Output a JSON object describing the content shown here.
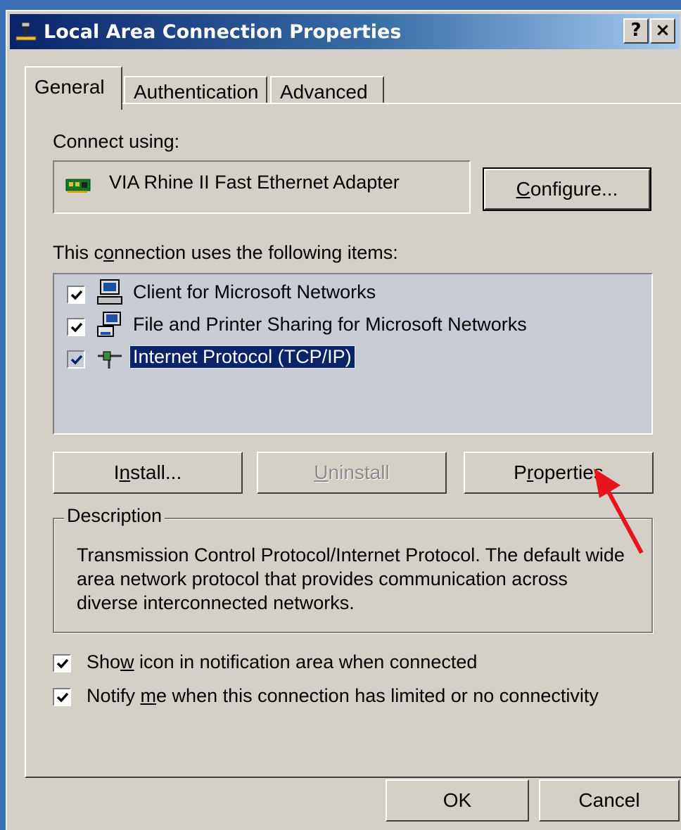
{
  "window": {
    "title": "Local Area Connection Properties",
    "help_button": "?",
    "close_button": "×"
  },
  "tabs": [
    {
      "label": "General",
      "active": true
    },
    {
      "label": "Authentication",
      "active": false
    },
    {
      "label": "Advanced",
      "active": false
    }
  ],
  "connect_using": {
    "label": "Connect using:",
    "adapter": "VIA Rhine II Fast Ethernet Adapter",
    "configure_button": {
      "pre": "",
      "mnemonic": "C",
      "post": "onfigure..."
    }
  },
  "items_section": {
    "label": {
      "pre": "This c",
      "mnemonic": "o",
      "post": "nnection uses the following items:"
    },
    "items": [
      {
        "label": "Client for Microsoft Networks",
        "checked": true,
        "icon": "network-client-icon",
        "selected": false
      },
      {
        "label": "File and Printer Sharing for Microsoft Networks",
        "checked": true,
        "icon": "file-printer-sharing-icon",
        "selected": false
      },
      {
        "label": "Internet Protocol (TCP/IP)",
        "checked": true,
        "icon": "network-protocol-icon",
        "selected": true
      }
    ]
  },
  "action_buttons": {
    "install": {
      "pre": "I",
      "mnemonic": "n",
      "post": "stall...",
      "enabled": true
    },
    "uninstall": {
      "pre": "",
      "mnemonic": "U",
      "post": "ninstall",
      "enabled": false
    },
    "properties": {
      "pre": "P",
      "mnemonic": "r",
      "post": "operties",
      "enabled": true
    }
  },
  "description": {
    "legend": "Description",
    "text": "Transmission Control Protocol/Internet Protocol. The default wide area network protocol that provides communication across diverse interconnected networks."
  },
  "options": [
    {
      "pre": "Sho",
      "mnemonic": "w",
      "post": " icon in notification area when connected",
      "checked": true
    },
    {
      "pre": "Notify ",
      "mnemonic": "m",
      "post": "e when this connection has limited or no connectivity",
      "checked": true
    }
  ],
  "footer": {
    "ok_button": "OK",
    "cancel_button": "Cancel"
  },
  "colors": {
    "titlebar_start": "#0a246a",
    "titlebar_end": "#a6caf0",
    "dialog_face": "#d4d0c8",
    "selection": "#0a246a",
    "annotation_arrow": "#e8141c"
  }
}
